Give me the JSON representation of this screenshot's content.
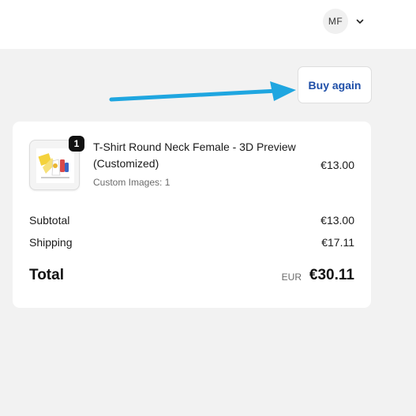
{
  "header": {
    "account_initials": "MF"
  },
  "actions": {
    "buy_again_label": "Buy again"
  },
  "order": {
    "item": {
      "quantity": "1",
      "title": "T-Shirt Round Neck Female - 3D Preview (Customized)",
      "meta": "Custom Images: 1",
      "price": "€13.00"
    },
    "subtotal_label": "Subtotal",
    "subtotal_value": "€13.00",
    "shipping_label": "Shipping",
    "shipping_value": "€17.11",
    "total_label": "Total",
    "currency": "EUR",
    "total_value": "€30.11"
  },
  "colors": {
    "annotation_arrow": "#1fa6e0",
    "link_text": "#1f4fa8",
    "page_background": "#f2f2f2"
  },
  "icons": {
    "account_menu": "chevron-down-icon",
    "annotation": "arrow-right-icon"
  }
}
